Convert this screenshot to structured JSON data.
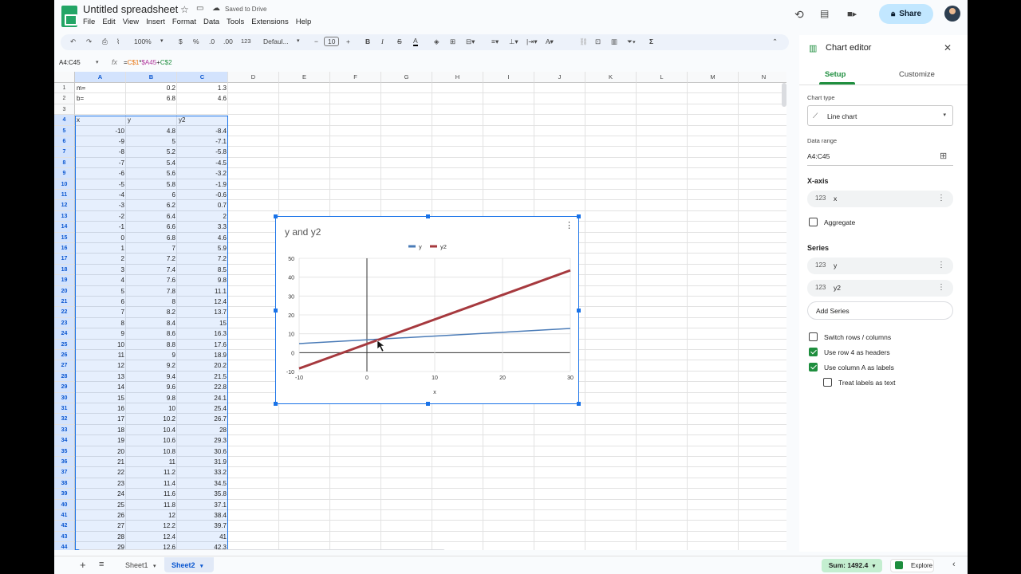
{
  "app": {
    "doc_title": "Untitled spreadsheet",
    "saved_status": "Saved to Drive",
    "menu": [
      "File",
      "Edit",
      "View",
      "Insert",
      "Format",
      "Data",
      "Tools",
      "Extensions",
      "Help"
    ],
    "share_label": "Share"
  },
  "toolbar": {
    "zoom": "100%",
    "currency": "$",
    "percent": "%",
    "decimals": ".0",
    "decimals_more": ".00",
    "number_format": "123",
    "font": "Defaul...",
    "font_size": "10",
    "minus": "−",
    "plus": "+",
    "bold": "B",
    "italic": "I",
    "strike": "S",
    "text_color": "A",
    "sum_icon": "Σ"
  },
  "formula_bar": {
    "name_box": "A4:C45",
    "fx": "fx",
    "formula_parts": [
      "=",
      "C$1",
      "*",
      "$A45",
      "+",
      "C$2"
    ]
  },
  "grid": {
    "columns": [
      "A",
      "B",
      "C",
      "D",
      "E",
      "F",
      "G",
      "H",
      "I",
      "J",
      "K",
      "L",
      "M",
      "N"
    ],
    "row_numbers": [
      "1",
      "2",
      "3",
      "4",
      "5",
      "6",
      "7",
      "8",
      "9",
      "10",
      "11",
      "12",
      "13",
      "14",
      "15",
      "16",
      "17",
      "18",
      "19",
      "20",
      "21",
      "22",
      "23",
      "24",
      "25",
      "26",
      "27",
      "28",
      "29",
      "30",
      "31",
      "32",
      "33",
      "34",
      "35",
      "36",
      "37",
      "38",
      "39",
      "40",
      "41",
      "42",
      "43",
      "44"
    ],
    "rows": [
      [
        "m=",
        "0.2",
        "1.3"
      ],
      [
        "b=",
        "6.8",
        "4.6"
      ],
      [
        "",
        "",
        ""
      ],
      [
        "x",
        "y",
        "y2"
      ],
      [
        "-10",
        "4.8",
        "-8.4"
      ],
      [
        "-9",
        "5",
        "-7.1"
      ],
      [
        "-8",
        "5.2",
        "-5.8"
      ],
      [
        "-7",
        "5.4",
        "-4.5"
      ],
      [
        "-6",
        "5.6",
        "-3.2"
      ],
      [
        "-5",
        "5.8",
        "-1.9"
      ],
      [
        "-4",
        "6",
        "-0.6"
      ],
      [
        "-3",
        "6.2",
        "0.7"
      ],
      [
        "-2",
        "6.4",
        "2"
      ],
      [
        "-1",
        "6.6",
        "3.3"
      ],
      [
        "0",
        "6.8",
        "4.6"
      ],
      [
        "1",
        "7",
        "5.9"
      ],
      [
        "2",
        "7.2",
        "7.2"
      ],
      [
        "3",
        "7.4",
        "8.5"
      ],
      [
        "4",
        "7.6",
        "9.8"
      ],
      [
        "5",
        "7.8",
        "11.1"
      ],
      [
        "6",
        "8",
        "12.4"
      ],
      [
        "7",
        "8.2",
        "13.7"
      ],
      [
        "8",
        "8.4",
        "15"
      ],
      [
        "9",
        "8.6",
        "16.3"
      ],
      [
        "10",
        "8.8",
        "17.6"
      ],
      [
        "11",
        "9",
        "18.9"
      ],
      [
        "12",
        "9.2",
        "20.2"
      ],
      [
        "13",
        "9.4",
        "21.5"
      ],
      [
        "14",
        "9.6",
        "22.8"
      ],
      [
        "15",
        "9.8",
        "24.1"
      ],
      [
        "16",
        "10",
        "25.4"
      ],
      [
        "17",
        "10.2",
        "26.7"
      ],
      [
        "18",
        "10.4",
        "28"
      ],
      [
        "19",
        "10.6",
        "29.3"
      ],
      [
        "20",
        "10.8",
        "30.6"
      ],
      [
        "21",
        "11",
        "31.9"
      ],
      [
        "22",
        "11.2",
        "33.2"
      ],
      [
        "23",
        "11.4",
        "34.5"
      ],
      [
        "24",
        "11.6",
        "35.8"
      ],
      [
        "25",
        "11.8",
        "37.1"
      ],
      [
        "26",
        "12",
        "38.4"
      ],
      [
        "27",
        "12.2",
        "39.7"
      ],
      [
        "28",
        "12.4",
        "41"
      ],
      [
        "29",
        "12.6",
        "42.3"
      ]
    ]
  },
  "chart_data": {
    "type": "line",
    "title": "y and y2",
    "xlabel": "x",
    "ylabel": "",
    "x_ticks": [
      "-10",
      "0",
      "10",
      "20",
      "30"
    ],
    "y_ticks": [
      "-10",
      "0",
      "10",
      "20",
      "30",
      "40",
      "50"
    ],
    "xlim": [
      -10,
      30
    ],
    "ylim": [
      -10,
      50
    ],
    "series": [
      {
        "name": "y",
        "color": "#4a7bb7",
        "x": [
          -10,
          30
        ],
        "values": [
          4.8,
          12.8
        ]
      },
      {
        "name": "y2",
        "color": "#a6393e",
        "x": [
          -10,
          30
        ],
        "values": [
          -8.4,
          43.6
        ]
      }
    ],
    "legend": "top"
  },
  "sidebar": {
    "title": "Chart editor",
    "tab_setup": "Setup",
    "tab_customize": "Customize",
    "chart_type_label": "Chart type",
    "chart_type_value": "Line chart",
    "data_range_label": "Data range",
    "data_range_value": "A4:C45",
    "xaxis_label": "X-axis",
    "xaxis_value": "x",
    "aggregate_label": "Aggregate",
    "series_label": "Series",
    "series_items": [
      "y",
      "y2"
    ],
    "add_series": "Add Series",
    "options": [
      {
        "label": "Switch rows / columns",
        "checked": false
      },
      {
        "label": "Use row 4 as headers",
        "checked": true
      },
      {
        "label": "Use column A as labels",
        "checked": true
      },
      {
        "label": "Treat labels as text",
        "checked": false
      }
    ],
    "icon_123": "123"
  },
  "bottom": {
    "sheets": [
      "Sheet1",
      "Sheet2"
    ],
    "active_sheet": "Sheet2",
    "sum_label": "Sum: 1492.4",
    "explore_label": "Explore"
  },
  "colors": {
    "accent": "#1a73e8",
    "selection": "#d3e3fd",
    "share_bg": "#c2e7ff",
    "sum_bg": "#c4eed0",
    "brand_green": "#23a566"
  }
}
